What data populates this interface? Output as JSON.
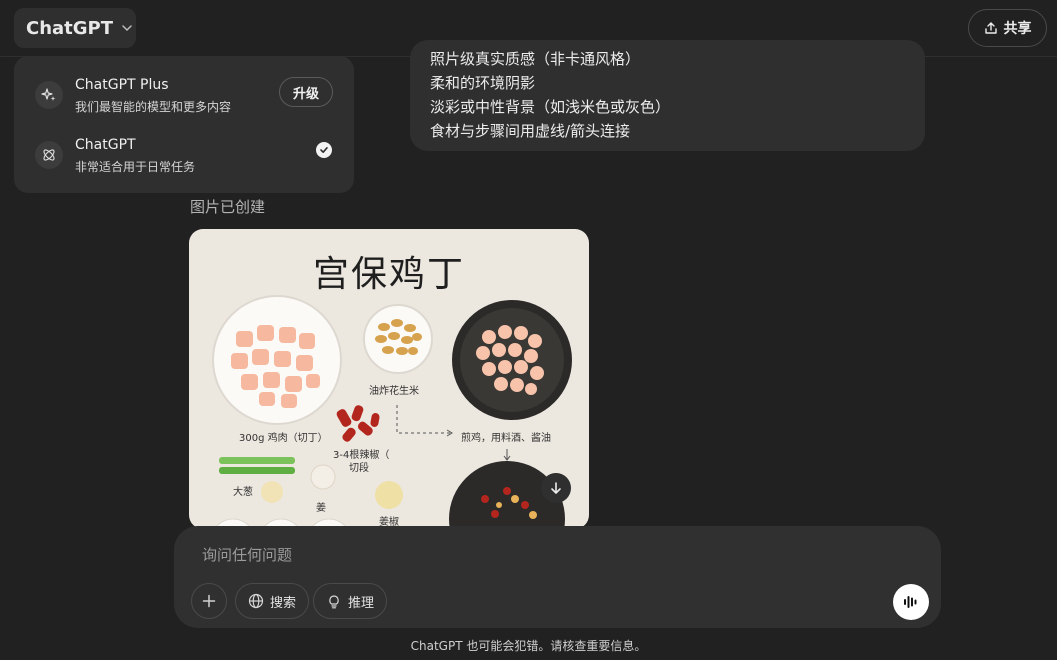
{
  "header": {
    "model_name": "ChatGPT",
    "share_label": "共享"
  },
  "model_menu": {
    "items": [
      {
        "name": "ChatGPT Plus",
        "desc": "我们最智能的模型和更多内容",
        "action": "升级",
        "icon": "sparkles-icon"
      },
      {
        "name": "ChatGPT",
        "desc": "非常适合用于日常任务",
        "selected": true,
        "icon": "atom-icon"
      }
    ]
  },
  "conversation": {
    "assistant_lines": [
      "照片级真实质感（非卡通风格）",
      "柔和的环境阴影",
      "淡彩或中性背景（如浅米色或灰色）",
      "食材与步骤间用虚线/箭头连接"
    ],
    "image_status": "图片已创建",
    "image": {
      "title": "宫保鸡丁",
      "captions": {
        "chicken": "300g 鸡肉（切丁）",
        "peanuts": "油炸花生米",
        "chilies": "3-4根辣椒（",
        "chilies2": "切段",
        "step": "煎鸡，用料酒、酱油",
        "scallion": "大葱",
        "garlic": "姜",
        "ginger": "姜椒"
      }
    }
  },
  "composer": {
    "placeholder": "询问任何问题",
    "search_label": "搜索",
    "reason_label": "推理"
  },
  "footer": {
    "disclaimer": "ChatGPT 也可能会犯错。请核查重要信息。"
  }
}
